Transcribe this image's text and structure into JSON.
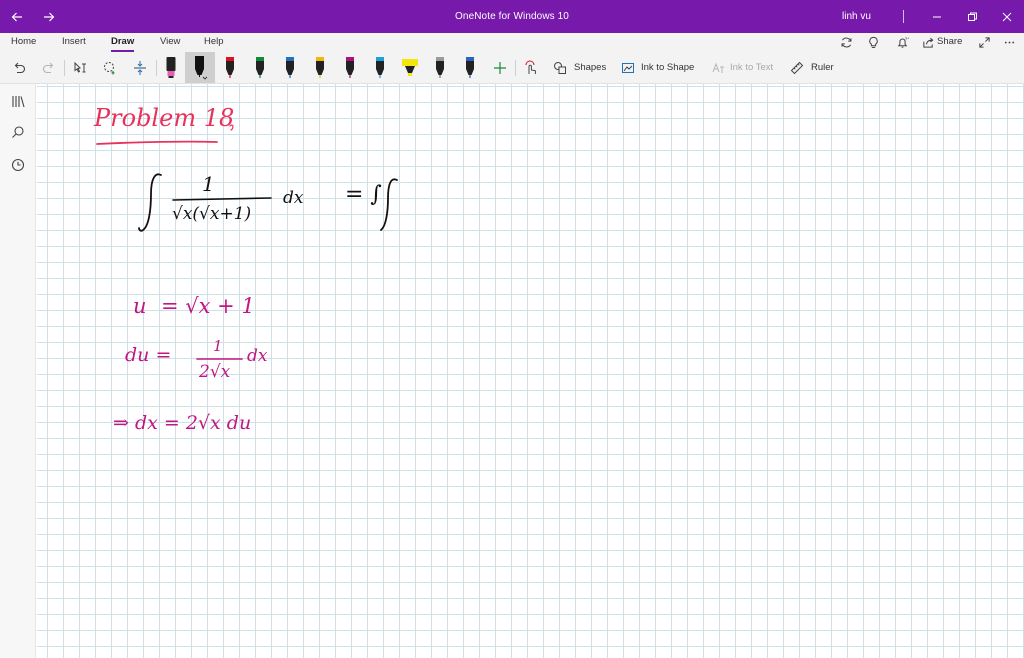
{
  "window": {
    "title": "OneNote for Windows 10",
    "user": "linh vu",
    "colors": {
      "titlebar": "#7719aa",
      "accent": "#7719aa"
    }
  },
  "ribbon": {
    "tabs": [
      {
        "label": "Home"
      },
      {
        "label": "Insert"
      },
      {
        "label": "Draw",
        "active": true
      },
      {
        "label": "View"
      },
      {
        "label": "Help"
      }
    ],
    "share_label": "Share"
  },
  "toolbar": {
    "shapes_label": "Shapes",
    "ink_to_shape_label": "Ink to Shape",
    "ink_to_text_label": "Ink to Text",
    "ruler_label": "Ruler",
    "pens": [
      {
        "color": "#e85bb6",
        "kind": "highlighter"
      },
      {
        "color": "#111111",
        "kind": "pen",
        "selected": true
      },
      {
        "color": "#e3101e",
        "kind": "pen"
      },
      {
        "color": "#0f8a3a",
        "kind": "pen"
      },
      {
        "color": "#1e73be",
        "kind": "pen"
      },
      {
        "color": "#f2b705",
        "kind": "pen"
      },
      {
        "color": "#b0127a",
        "kind": "pen"
      },
      {
        "color": "#1aa3d9",
        "kind": "pen"
      },
      {
        "color": "#f5e60a",
        "kind": "highlighter"
      },
      {
        "color": "#7a7a7a",
        "kind": "pen"
      },
      {
        "color": "#2a63c2",
        "kind": "pen"
      }
    ]
  },
  "notes": {
    "heading": "Problem 18",
    "ink_colors": {
      "heading": "#e8325a",
      "black": "#111111",
      "magenta": "#c01683"
    },
    "integrand_numerator": "1",
    "integrand_denominator": "√x(√x+1)",
    "integrand_dx": "dx",
    "equals_integral": "= ∫",
    "sub_u_lhs": "u",
    "sub_u_rhs": "= √x + 1",
    "sub_du_lhs": "du =",
    "sub_du_num": "1",
    "sub_du_den": "2√x",
    "sub_du_dx": "dx",
    "result_line": "⇒ dx = 2√x du"
  }
}
